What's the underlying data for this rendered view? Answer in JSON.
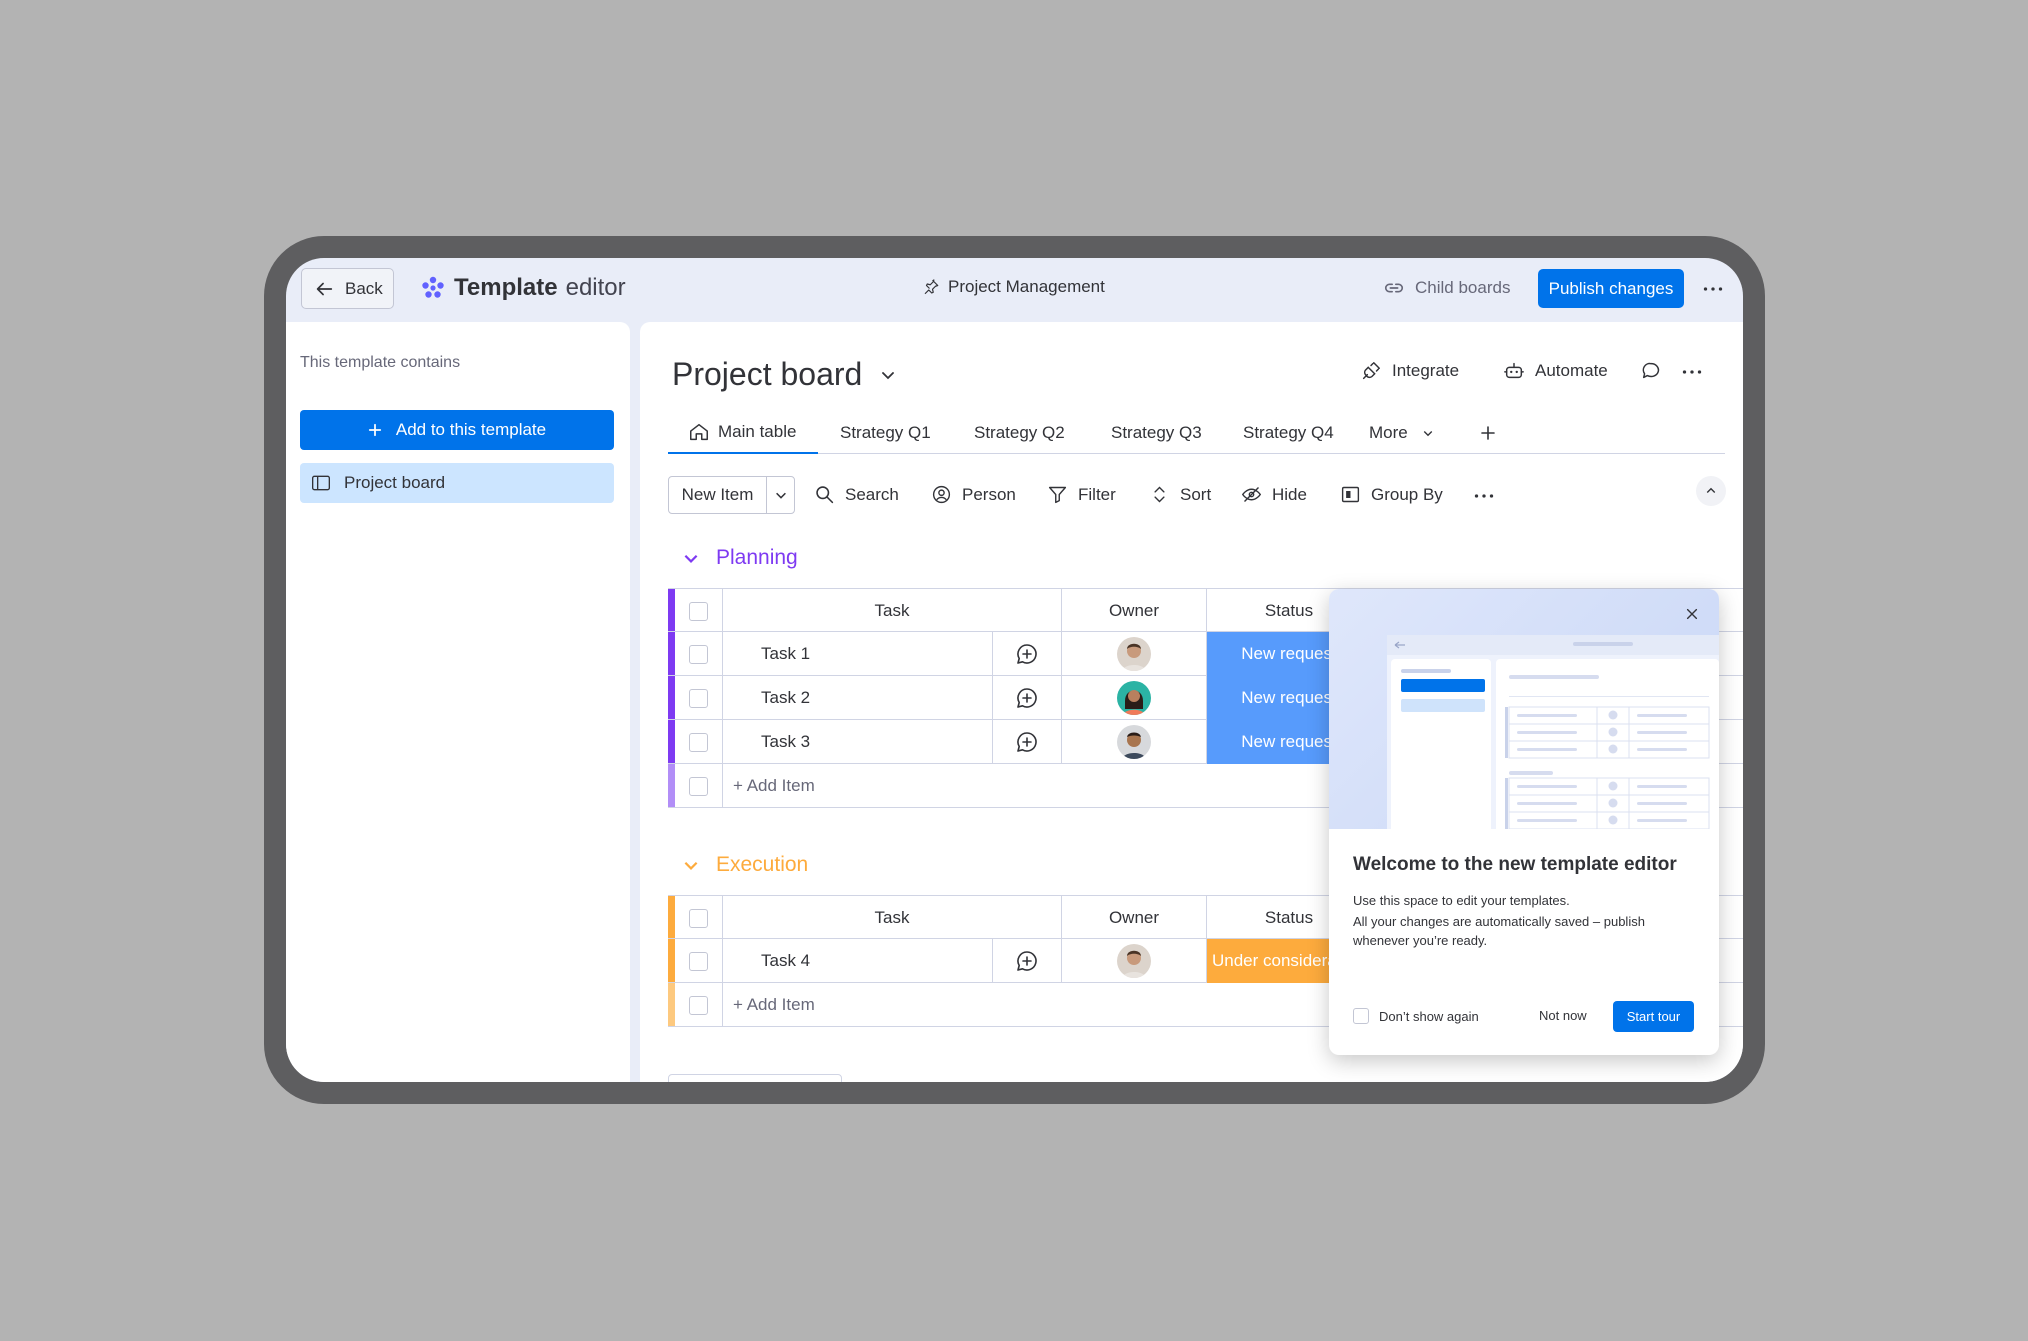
{
  "topbar": {
    "back_label": "Back",
    "logo_bold": "Template",
    "logo_light": "editor",
    "crumb": "Project Management",
    "child_boards": "Child boards",
    "publish": "Publish changes"
  },
  "sidebar": {
    "caption": "This template contains",
    "add_button": "Add to this template",
    "items": [
      {
        "label": "Project board"
      }
    ]
  },
  "board": {
    "title": "Project board",
    "actions": {
      "integrate": "Integrate",
      "automate": "Automate"
    },
    "tabs": [
      {
        "label": "Main table"
      },
      {
        "label": "Strategy Q1"
      },
      {
        "label": "Strategy Q2"
      },
      {
        "label": "Strategy Q3"
      },
      {
        "label": "Strategy Q4"
      },
      {
        "label": "More"
      }
    ],
    "toolbar": {
      "new_item": "New Item",
      "search": "Search",
      "person": "Person",
      "filter": "Filter",
      "sort": "Sort",
      "hide": "Hide",
      "group_by": "Group By"
    },
    "columns": {
      "task": "Task",
      "owner": "Owner",
      "status": "Status"
    },
    "add_item": "+ Add Item",
    "groups": [
      {
        "name": "Planning",
        "color": "#7e3af2",
        "rows": [
          {
            "task": "Task 1",
            "status": "New request"
          },
          {
            "task": "Task 2",
            "status": "New request"
          },
          {
            "task": "Task 3",
            "status": "New request"
          }
        ]
      },
      {
        "name": "Execution",
        "color": "#fdab3d",
        "rows": [
          {
            "task": "Task 4",
            "status": "Under consideration"
          }
        ]
      }
    ]
  },
  "popup": {
    "title": "Welcome to the new template editor",
    "line1": "Use this space to edit your templates.",
    "line2": "All your changes are automatically saved – publish",
    "line3": "whenever you’re ready.",
    "dont_show": "Don’t show again",
    "not_now": "Not now",
    "start_tour": "Start tour"
  },
  "colors": {
    "accent": "#0073ea",
    "planning": "#7e3af2",
    "execution": "#fdab3d",
    "status_new": "#579bfc",
    "status_under": "#fdab3d"
  }
}
